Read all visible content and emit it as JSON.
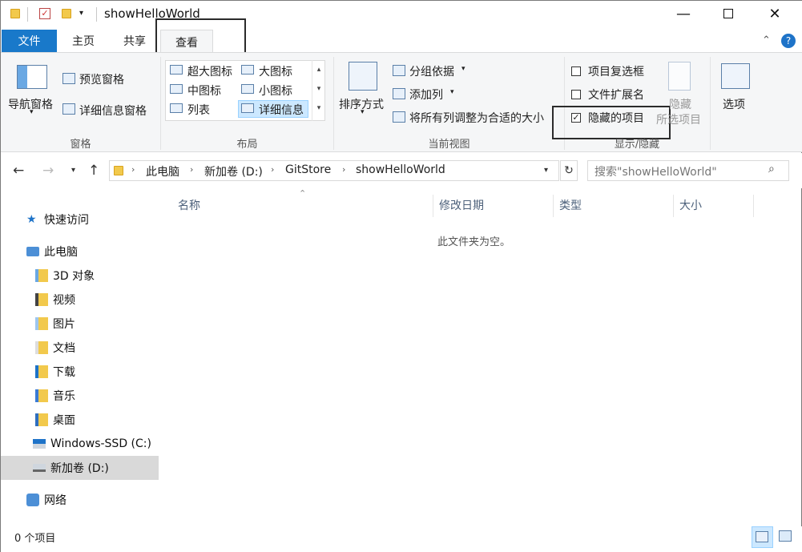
{
  "window": {
    "title": "showHelloWorld"
  },
  "tabs": {
    "file": "文件",
    "home": "主页",
    "share": "共享",
    "view": "查看"
  },
  "ribbon": {
    "pane_group": {
      "label": "窗格",
      "nav_pane": "导航窗格",
      "preview_pane": "预览窗格",
      "details_pane": "详细信息窗格"
    },
    "layout_group": {
      "label": "布局",
      "items": [
        "超大图标",
        "大图标",
        "中图标",
        "小图标",
        "列表",
        "详细信息"
      ]
    },
    "current_view_group": {
      "label": "当前视图",
      "sort_by": "排序方式",
      "group_by": "分组依据",
      "add_columns": "添加列",
      "size_all_columns": "将所有列调整为合适的大小"
    },
    "show_hide_group": {
      "label": "显示/隐藏",
      "item_checkboxes": "项目复选框",
      "file_extensions": "文件扩展名",
      "hidden_items": "隐藏的项目",
      "hide_selected_1": "隐藏",
      "hide_selected_2": "所选项目"
    },
    "options": "选项"
  },
  "address": {
    "crumbs": [
      "此电脑",
      "新加卷 (D:)",
      "GitStore",
      "showHelloWorld"
    ],
    "search_placeholder": "搜索\"showHelloWorld\""
  },
  "nav": {
    "quick_access": "快速访问",
    "this_pc": "此电脑",
    "obj3d": "3D 对象",
    "videos": "视频",
    "pictures": "图片",
    "documents": "文档",
    "downloads": "下载",
    "music": "音乐",
    "desktop": "桌面",
    "drive_c": "Windows-SSD (C:)",
    "drive_d": "新加卷 (D:)",
    "network": "网络"
  },
  "columns": {
    "name": "名称",
    "date": "修改日期",
    "type": "类型",
    "size": "大小"
  },
  "empty_message": "此文件夹为空。",
  "status": {
    "count": "0 个项目"
  }
}
